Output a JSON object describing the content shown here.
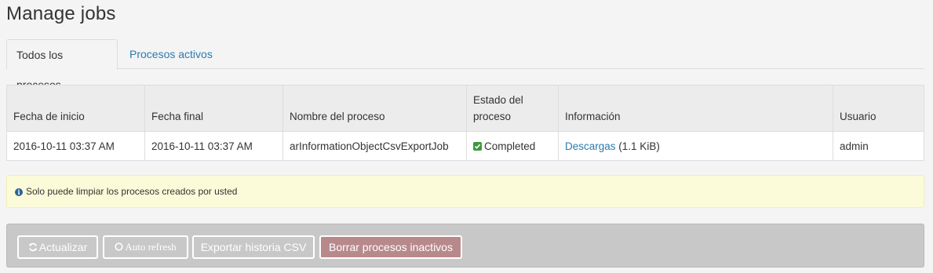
{
  "page": {
    "title": "Manage jobs"
  },
  "tabs": [
    {
      "label": "Todos los procesos",
      "active": true
    },
    {
      "label": "Procesos activos",
      "active": false
    }
  ],
  "table": {
    "headers": [
      "Fecha de inicio",
      "Fecha final",
      "Nombre del proceso",
      "Estado del proceso",
      "Información",
      "Usuario"
    ],
    "rows": [
      {
        "start": "2016-10-11 03:37 AM",
        "end": "2016-10-11 03:37 AM",
        "name": "arInformationObjectCsvExportJob",
        "status": "Completed",
        "info_link": "Descargas",
        "info_size": "(1.1 KiB)",
        "user": "admin"
      }
    ]
  },
  "alert": {
    "text": "Solo puede limpiar los procesos creados por usted",
    "icon": "info-icon"
  },
  "actions": {
    "refresh": "Actualizar",
    "auto_refresh": "Auto refresh",
    "export": "Exportar historia CSV",
    "delete": "Borrar procesos inactivos"
  },
  "colors": {
    "link": "#2a7ab0",
    "status_success": "#3c9a3c",
    "alert_bg": "#fcfbd9",
    "delete_button": "#b8898b"
  }
}
